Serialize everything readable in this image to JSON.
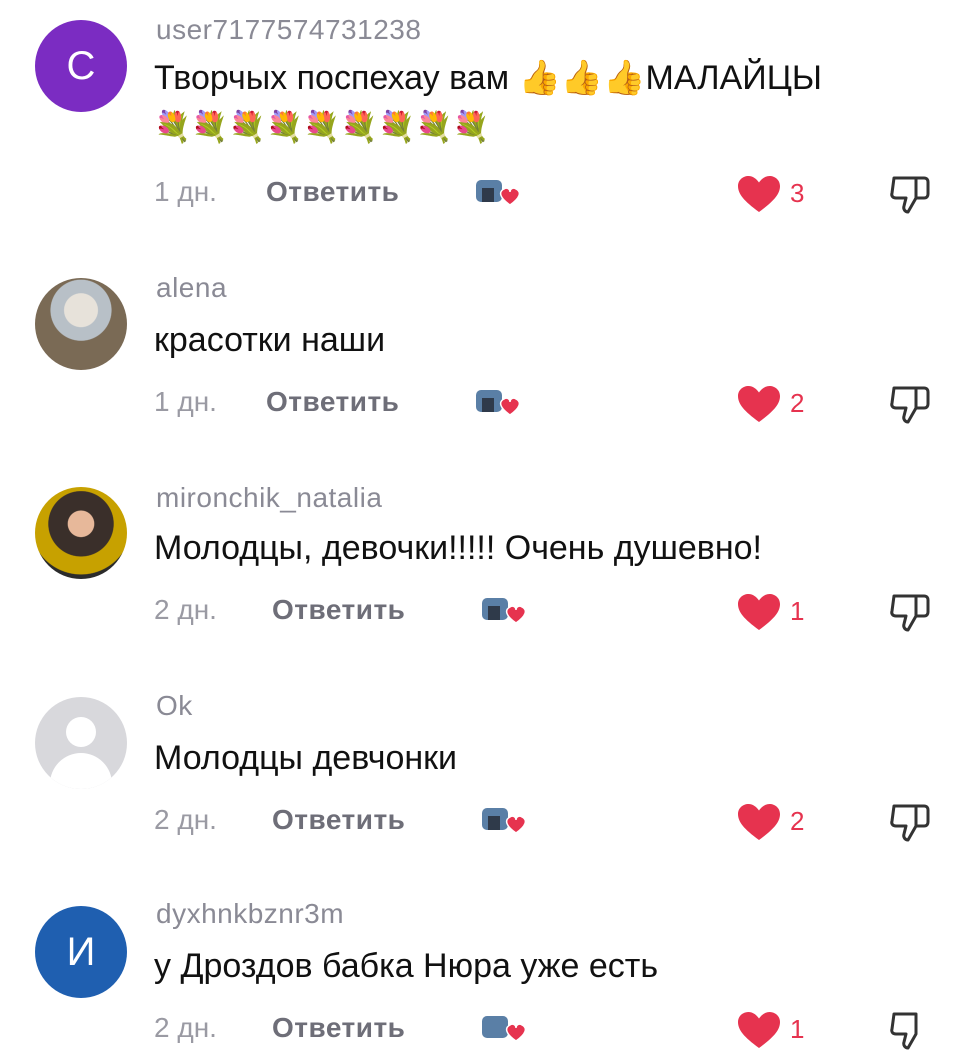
{
  "comments": [
    {
      "username": "user7177574731238",
      "avatar_letter": "C",
      "text": "Творчых поспехау вам 👍👍👍МАЛАЙЦЫ",
      "emoji_line": "💐💐💐💐💐💐💐💐💐",
      "time": "1 дн.",
      "reply_label": "Ответить",
      "likes": "3"
    },
    {
      "username": "alena",
      "text": "красотки наши",
      "time": "1 дн.",
      "reply_label": "Ответить",
      "likes": "2"
    },
    {
      "username": "mironchik_natalia",
      "text": "Молодцы, девочки!!!!! Очень душевно!",
      "time": "2 дн.",
      "reply_label": "Ответить",
      "likes": "1"
    },
    {
      "username": "Ok",
      "text": "Молодцы девчонки",
      "time": "2 дн.",
      "reply_label": "Ответить",
      "likes": "2"
    },
    {
      "username": "dyxhnkbznr3m",
      "avatar_letter": "И",
      "text": "у Дроздов бабка Нюра уже есть",
      "time": "2 дн.",
      "reply_label": "Ответить",
      "likes": "1"
    }
  ],
  "colors": {
    "like_red": "#e6334f",
    "muted": "#8a8a95"
  },
  "icons": {
    "like": "heart-icon",
    "dislike": "thumbs-down-icon",
    "creator_reaction": "creator-liked-icon"
  }
}
